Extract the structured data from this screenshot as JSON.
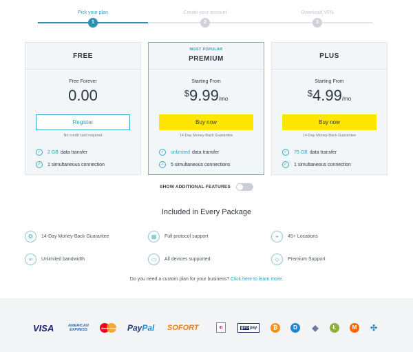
{
  "stepper": {
    "steps": [
      {
        "label": "Pick your plan",
        "number": "1"
      },
      {
        "label": "Create your account",
        "number": "2"
      },
      {
        "label": "Download VPN",
        "number": "3"
      }
    ]
  },
  "plans": {
    "free": {
      "name": "FREE",
      "caption": "Free Forever",
      "price": "0.00",
      "button": "Register",
      "note": "No credit card required",
      "features": [
        {
          "highlight": "2 GB",
          "text": "data transfer"
        },
        {
          "highlight": "",
          "text": "1 simultaneous connection"
        }
      ]
    },
    "premium": {
      "tag": "MOST POPULAR",
      "name": "PREMIUM",
      "caption": "Starting From",
      "currency": "$",
      "price": "9.99",
      "period": "/mo",
      "button": "Buy now",
      "note": "14-Day Money-Back Guarantee",
      "features": [
        {
          "highlight": "unlimited",
          "text": "data transfer"
        },
        {
          "highlight": "",
          "text": "5 simultaneous connections"
        }
      ]
    },
    "plus": {
      "name": "PLUS",
      "caption": "Starting From",
      "currency": "$",
      "price": "4.99",
      "period": "/mo",
      "button": "Buy now",
      "note": "14-Day Money-Back Guarantee",
      "features": [
        {
          "highlight": "75 GB",
          "text": "data transfer"
        },
        {
          "highlight": "",
          "text": "1 simultaneous connection"
        }
      ]
    }
  },
  "toggle": {
    "label": "SHOW ADDITIONAL FEATURES",
    "on": false
  },
  "included": {
    "title": "Included in Every Package",
    "items": [
      {
        "label": "14-Day Money-Back Guarantee",
        "icon": "guarantee-icon"
      },
      {
        "label": "Full protocol support",
        "icon": "protocol-icon"
      },
      {
        "label": "45+ Locations",
        "icon": "location-pin-icon"
      },
      {
        "label": "Unlimited bandwidth",
        "icon": "bandwidth-icon"
      },
      {
        "label": "All devices supported",
        "icon": "devices-icon"
      },
      {
        "label": "Premium Support",
        "icon": "diamond-icon"
      }
    ]
  },
  "custom": {
    "text": "Do you need a custom plan for your business?",
    "link": "Click here to learn more."
  },
  "payments": {
    "visa": "VISA",
    "amex_line1": "AMERICAN",
    "amex_line2": "EXPRESS",
    "mastercard": "MasterCard",
    "paypal_a": "Pay",
    "paypal_b": "Pal",
    "sofort": "SOFORT",
    "ideal": "iD",
    "giropay_a": "giro",
    "giropay_b": "pay",
    "coins": [
      "bitcoin-icon",
      "dash-icon",
      "ethereum-icon",
      "litecoin-icon",
      "monero-icon",
      "ripple-icon"
    ]
  },
  "colors": {
    "accent": "#2f9fc2",
    "buy_button": "#ffe600",
    "card_background": "#f3f6f9",
    "footer_background": "#f2f4f6"
  }
}
